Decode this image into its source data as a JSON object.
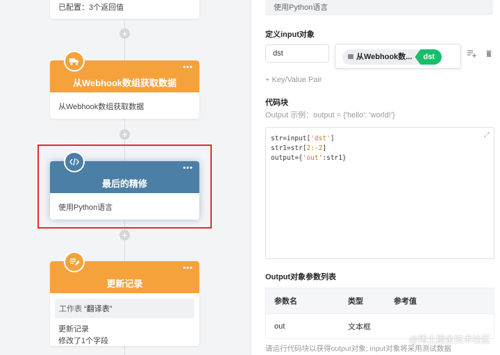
{
  "canvas": {
    "top_node": {
      "configured_text": "已配置：3个返回值"
    },
    "webhook_node": {
      "title": "从Webhook数组获取数据",
      "description": "从Webhook数组获取数据",
      "icon": "truck-icon"
    },
    "refine_node": {
      "title": "最后的精修",
      "description": "使用Python语言",
      "icon": "code-icon"
    },
    "update_node": {
      "title": "更新记录",
      "sheet_prefix": "工作表",
      "sheet_name": "“翻译表”",
      "line1": "更新记录",
      "line2": "修改了1个字段",
      "icon": "edit-list-icon"
    },
    "more_label": "•••",
    "add_label": "+"
  },
  "panel": {
    "language_value": "使用Python语言",
    "input_section_title": "定义input对象",
    "input_key": "dst",
    "input_value_chip": {
      "source": "从Webhook数...",
      "field": "dst"
    },
    "add_pair_label": "+ Key/Value Pair",
    "code_section_title": "代码块",
    "code_hint": "Output 示例：output = {'hello': 'world!'}",
    "code_lines": [
      {
        "a": "str=input[",
        "s": "'dst'",
        "b": "]"
      },
      {
        "a": "str1=str[",
        "s": "2:-2",
        "b": "]"
      },
      {
        "a": "output={",
        "s": "'out'",
        "b": ":str1}"
      }
    ],
    "output_section_title": "Output对象参数列表",
    "table_headers": [
      "参数名",
      "类型",
      "参考值"
    ],
    "table_rows": [
      {
        "name": "out",
        "type": "文本框",
        "ref": ""
      }
    ],
    "footer_note": "请运行代码块以获得output对象; input对象将采用测试数据"
  },
  "watermark": "@稀土掘金技术社区",
  "colors": {
    "orange": "#f5a23c",
    "steel_blue": "#4b7fa6",
    "green": "#19be6b",
    "highlight_red": "#e02b2b"
  }
}
